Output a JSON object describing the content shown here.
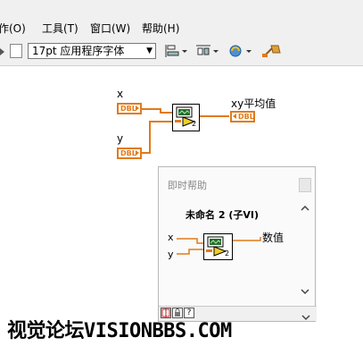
{
  "menubar": {
    "items": [
      {
        "label": "作(O)"
      },
      {
        "label": "工具(T)"
      },
      {
        "label": "窗口(W)"
      },
      {
        "label": "帮助(H)"
      }
    ]
  },
  "toolbar": {
    "font_select": "17pt 应用程序字体",
    "icons": [
      "align-objects-icon",
      "distribute-objects-icon",
      "reorder-icon",
      "cleanup-diagram-icon"
    ]
  },
  "diagram": {
    "input_x_label": "x",
    "input_y_label": "y",
    "output_label": "xy平均值",
    "dbl_text": "DBL",
    "subvi_number": "2"
  },
  "help": {
    "title": "即时帮助",
    "vi_name": "未命名 2 (子VI)",
    "x_label": "x",
    "y_label": "y",
    "output_label": "数值",
    "subvi_number": "2"
  },
  "watermark": "视觉论坛VISIONBBS.COM",
  "colors": {
    "wire": "#e07b1a",
    "background": "#ffffff",
    "toolbar": "#f0f0f0"
  }
}
